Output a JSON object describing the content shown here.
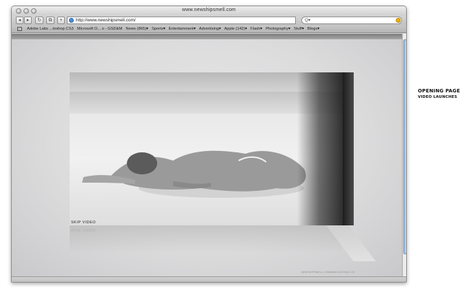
{
  "window": {
    "title": "www.newshipsmell.com"
  },
  "toolbar": {
    "back": "◂",
    "forward": "▸",
    "reload": "↻",
    "bookmark_icon": "⧉",
    "add": "+",
    "url": "http://www.newshipsmell.com/",
    "search_prefix": "Q▾"
  },
  "bookmarks": {
    "items": [
      "Adobe Labs ...toshop CS3",
      "Microsoft O... o - GSD&M",
      "News (865)▾",
      "Sports▾",
      "Entertainment▾",
      "Advertising▾",
      "Apple (142)▾",
      "Flash▾",
      "Photography▾",
      "Stuff▾",
      "Blogs▾"
    ]
  },
  "page": {
    "skip_label": "SKIP VIDEO",
    "copyright": "NEWSHIPSMELL COMMUNICATIONS LTD"
  },
  "caption": {
    "line1": "OPENING PAGE",
    "line2": "VIDEO LAUNCHES"
  },
  "colors": {
    "scroll_thumb": "#8fb3dd",
    "search_icon": "#f0b400",
    "globe": "#4c8fd6"
  },
  "icons": [
    "back-arrow-icon",
    "forward-arrow-icon",
    "reload-icon",
    "bookmarks-icon",
    "add-tab-icon",
    "globe-icon",
    "search-icon",
    "snapback-icon",
    "bookmarks-bar-icon"
  ]
}
